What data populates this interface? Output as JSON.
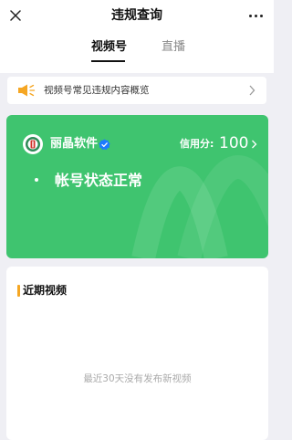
{
  "header": {
    "title": "违规查询",
    "tabs": [
      {
        "label": "视频号",
        "active": true
      },
      {
        "label": "直播",
        "active": false
      }
    ]
  },
  "notice": {
    "text": "视频号常见违规内容概览",
    "icon": "speaker-icon"
  },
  "account": {
    "name": "丽晶软件",
    "verified": true,
    "credit_label": "信用分:",
    "credit_score": "100",
    "status": "帐号状态正常"
  },
  "recent": {
    "title": "近期视频",
    "empty_text": "最近30天没有发布新视频"
  },
  "colors": {
    "accent_green": "#3fc46f",
    "notice_yellow": "#f5a623",
    "verified_blue": "#1e7bff"
  }
}
